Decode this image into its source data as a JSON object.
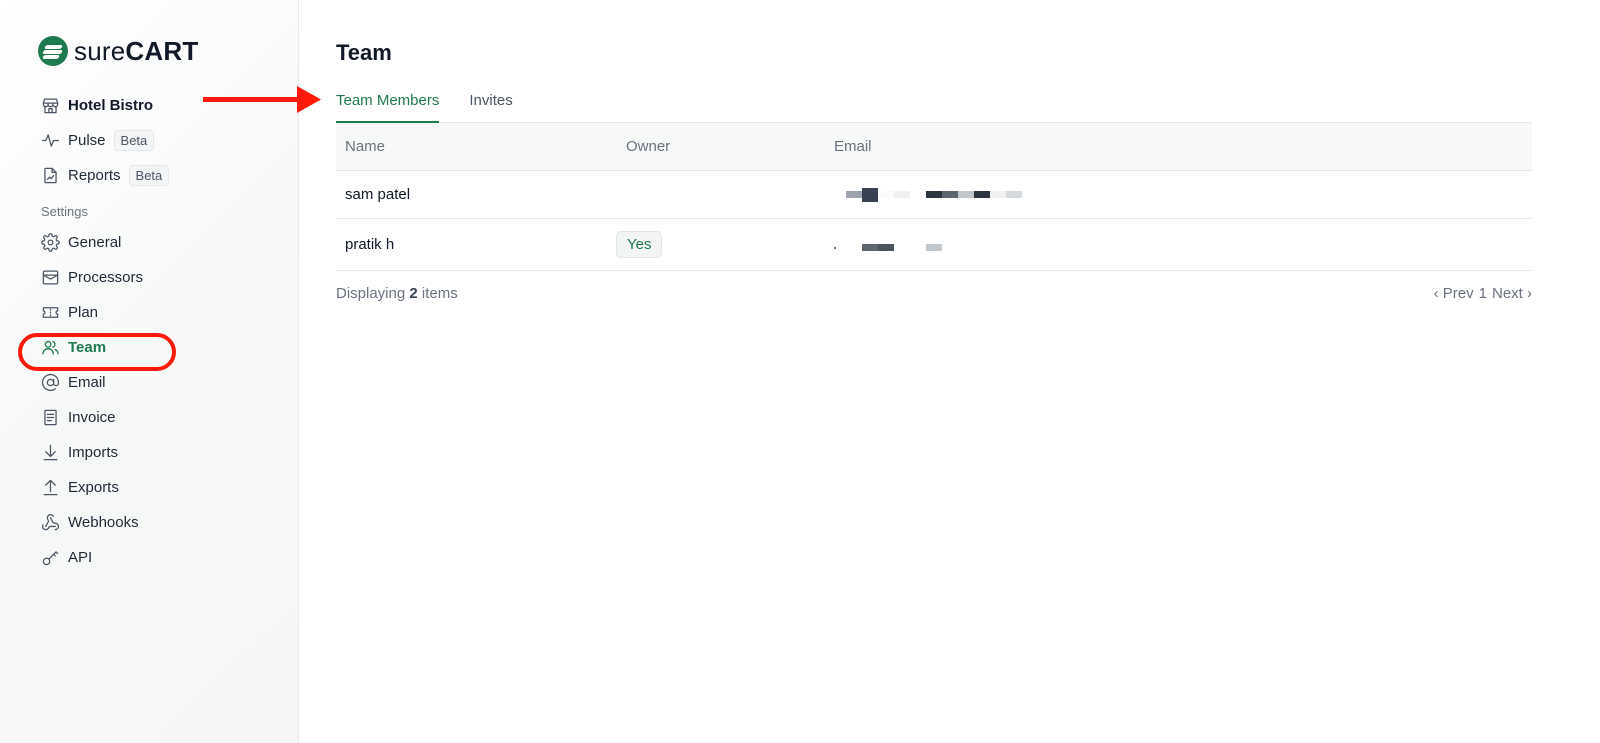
{
  "brand": {
    "name_light": "sure",
    "name_bold": "CART",
    "color": "#1d7a4e"
  },
  "sidebar": {
    "store": {
      "label": "Hotel Bistro",
      "icon": "store-icon"
    },
    "top_items": [
      {
        "label": "Pulse",
        "badge": "Beta",
        "icon": "pulse-icon"
      },
      {
        "label": "Reports",
        "badge": "Beta",
        "icon": "report-icon"
      }
    ],
    "section_label": "Settings",
    "items": [
      {
        "label": "General",
        "icon": "gear-icon"
      },
      {
        "label": "Processors",
        "icon": "processors-icon"
      },
      {
        "label": "Plan",
        "icon": "ticket-icon"
      },
      {
        "label": "Team",
        "icon": "users-icon",
        "active": true
      },
      {
        "label": "Email",
        "icon": "at-icon"
      },
      {
        "label": "Invoice",
        "icon": "invoice-icon"
      },
      {
        "label": "Imports",
        "icon": "download-icon"
      },
      {
        "label": "Exports",
        "icon": "upload-icon"
      },
      {
        "label": "Webhooks",
        "icon": "webhook-icon"
      },
      {
        "label": "API",
        "icon": "key-icon"
      }
    ]
  },
  "main": {
    "title": "Team",
    "tabs": [
      {
        "label": "Team Members",
        "active": true
      },
      {
        "label": "Invites",
        "active": false
      }
    ],
    "table": {
      "columns": [
        "Name",
        "Owner",
        "Email"
      ],
      "rows": [
        {
          "name": "sam patel",
          "owner": "",
          "email": "[redacted]"
        },
        {
          "name": "pratik h",
          "owner": "Yes",
          "email": "[redacted]"
        }
      ]
    },
    "footer": {
      "prefix": "Displaying",
      "count": "2",
      "suffix": "items",
      "prev": "‹ Prev",
      "page": "1",
      "next": "Next ›"
    }
  },
  "annotations": {
    "highlight_color": "#ff1a0a"
  }
}
